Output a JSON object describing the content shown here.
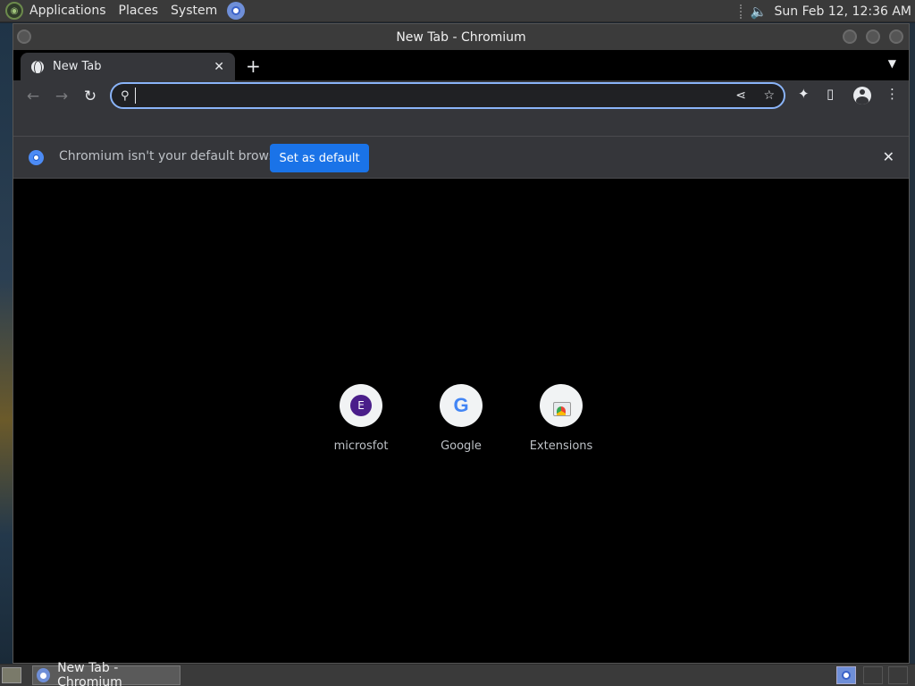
{
  "top_panel": {
    "menus": [
      "Applications",
      "Places",
      "System"
    ],
    "clock": "Sun Feb 12, 12:36 AM",
    "icons": [
      "distro-logo",
      "chromium-launcher-icon",
      "volume-icon"
    ]
  },
  "window": {
    "title": "New Tab - Chromium"
  },
  "tabs": [
    {
      "title": "New Tab",
      "icon": "globe-icon",
      "active": true
    }
  ],
  "toolbar": {
    "back": "←",
    "forward": "→",
    "reload": "↻",
    "search_icon": "🔍",
    "address_value": "",
    "share": "⋖",
    "bookmark": "☆",
    "extensions": "✦",
    "side_panel": "▯",
    "menu": "⋮"
  },
  "infobar": {
    "message": "Chromium isn't your default browser",
    "button_label": "Set as default",
    "close": "✕"
  },
  "shortcuts": [
    {
      "label": "microsfot",
      "letter": "E"
    },
    {
      "label": "Google",
      "letter": "G"
    },
    {
      "label": "Extensions"
    }
  ],
  "taskbar": {
    "items": [
      {
        "label": "New Tab - Chromium"
      }
    ]
  },
  "colors": {
    "omnibox_focus": "#8ab4f8",
    "primary_button": "#1a73e8",
    "shortcut_avatar": "#4a1e8a"
  }
}
